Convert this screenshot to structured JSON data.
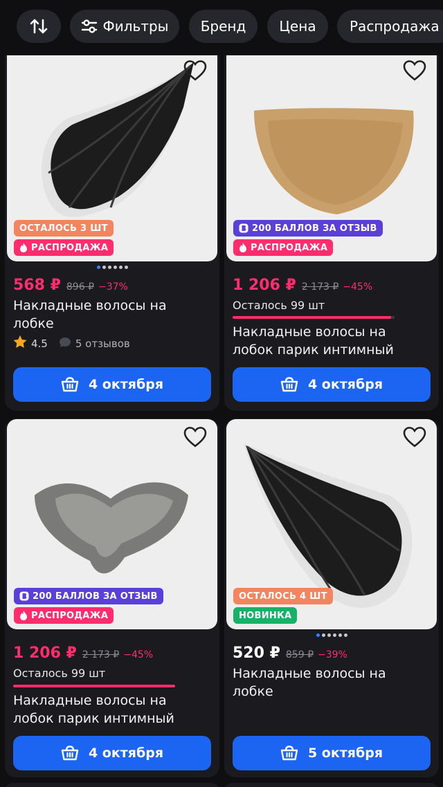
{
  "filters": {
    "sort_icon": "sort-arrows-icon",
    "filters_label": "Фильтры",
    "filters_icon": "sliders-icon",
    "brand_label": "Бренд",
    "price_label": "Цена",
    "sale_label": "Распродажа"
  },
  "colors": {
    "accent_blue": "#1c64f2",
    "sale_pink": "#ff2d6e",
    "stock_orange": "#f4845f",
    "points_purple": "#5b3fd9",
    "new_green": "#17b169",
    "star_yellow": "#f5a623"
  },
  "products": [
    {
      "badges": [
        "ОСТАЛОСЬ 3 ШТ",
        "РАСПРОДАЖА"
      ],
      "price": "568 ₽",
      "old_price": "896 ₽",
      "discount": "−37%",
      "title_line1": "Накладные волосы на",
      "title_line2": "лобке",
      "rating": "4.5",
      "reviews": "5 отзывов",
      "delivery": "4 октября",
      "image_index": 1,
      "image_count": 6
    },
    {
      "badges": [
        "200 БАЛЛОВ ЗА ОТЗЫВ",
        "РАСПРОДАЖА"
      ],
      "price": "1 206 ₽",
      "old_price": "2 173 ₽",
      "discount": "−45%",
      "stock_text": "Осталось 99 шт",
      "stock_level": 0.98,
      "title_line1": "Накладные волосы на",
      "title_line2": "лобок парик интимный",
      "delivery": "4 октября"
    },
    {
      "badges": [
        "200 БАЛЛОВ ЗА ОТЗЫВ",
        "РАСПРОДАЖА"
      ],
      "price": "1 206 ₽",
      "old_price": "2 173 ₽",
      "discount": "−45%",
      "stock_text": "Осталось 99 шт",
      "stock_level": 1.0,
      "title_line1": "Накладные волосы на",
      "title_line2": "лобок парик интимный",
      "delivery": "4 октября"
    },
    {
      "badges": [
        "ОСТАЛОСЬ 4 ШТ",
        "НОВИНКА"
      ],
      "price": "520 ₽",
      "old_price": "859 ₽",
      "discount": "−39%",
      "title_line1": "Накладные волосы на",
      "title_line2": "лобке",
      "delivery": "5 октября",
      "image_index": 1,
      "image_count": 6
    }
  ],
  "icons": {
    "favorite": "heart-outline-icon",
    "sale": "flame-icon",
    "points": "points-b-icon",
    "cart": "basket-icon",
    "star": "star-icon",
    "reviews": "speech-bubble-icon"
  }
}
